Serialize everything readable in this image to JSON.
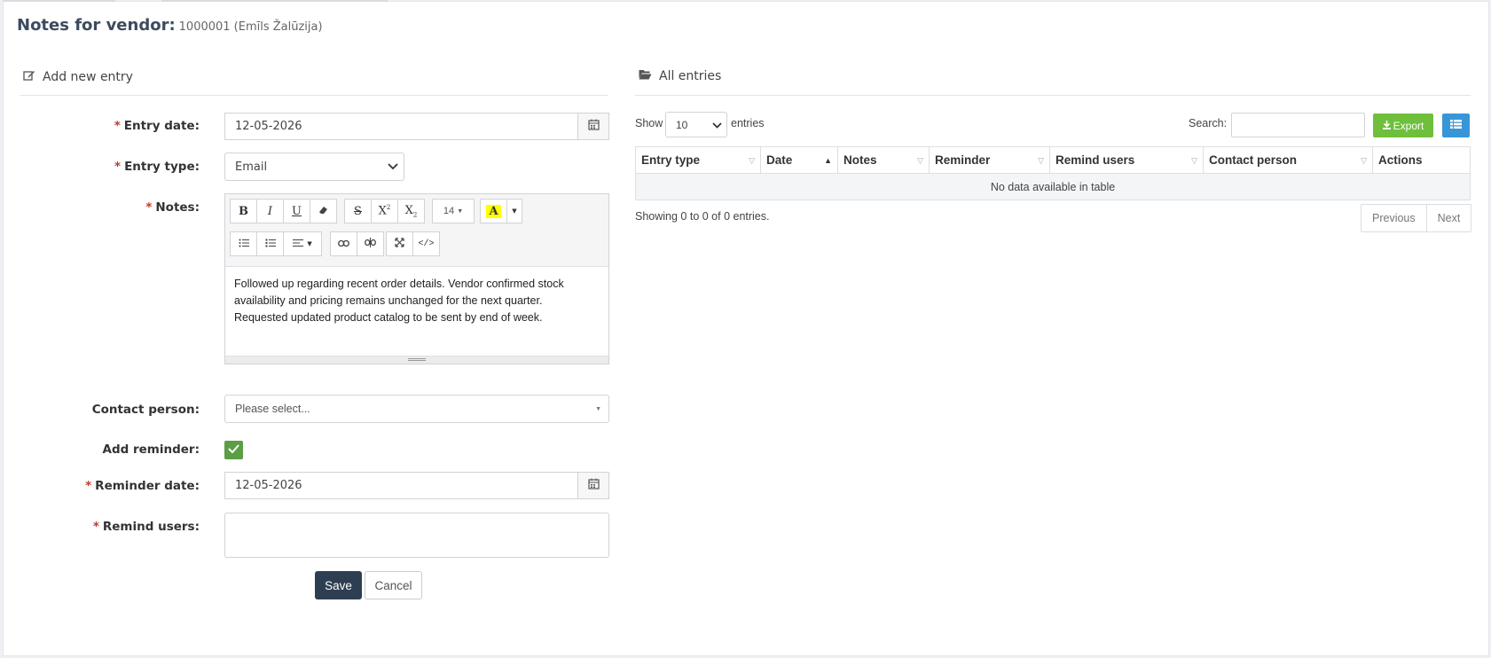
{
  "page": {
    "title": "Notes for vendor:",
    "vendor": "1000001 (Emīls Žalūzija)"
  },
  "form": {
    "section_title": "Add new entry",
    "required_mark": "*",
    "entry_date_label": "Entry date:",
    "entry_date_value": "12-05-2026",
    "entry_type_label": "Entry type:",
    "entry_type_value": "Email",
    "notes_label": "Notes:",
    "font_size": "14",
    "notes_text": "Followed up regarding recent order details. Vendor confirmed stock availability and pricing remains unchanged for the next quarter. Requested updated product catalog to be sent by end of week.",
    "contact_person_label": "Contact person:",
    "contact_person_placeholder": "Please select...",
    "add_reminder_label": "Add reminder:",
    "add_reminder_checked": true,
    "reminder_date_label": "Reminder date:",
    "reminder_date_value": "12-05-2026",
    "remind_users_label": "Remind users:",
    "save_label": "Save",
    "cancel_label": "Cancel"
  },
  "entries": {
    "section_title": "All entries",
    "show_label": "Show",
    "page_size": "10",
    "entries_label": "entries",
    "search_label": "Search:",
    "export_label": "Export",
    "columns": [
      "Entry type",
      "Date",
      "Notes",
      "Reminder",
      "Remind users",
      "Contact person",
      "Actions"
    ],
    "empty_message": "No data available in table",
    "summary": "Showing 0 to 0 of 0 entries.",
    "prev_label": "Previous",
    "next_label": "Next"
  },
  "colors": {
    "save_button": "#2e3e52",
    "export_button": "#6fbf3c",
    "columns_button": "#3896d8",
    "checkbox": "#5b9e45",
    "required": "#c0392b"
  }
}
